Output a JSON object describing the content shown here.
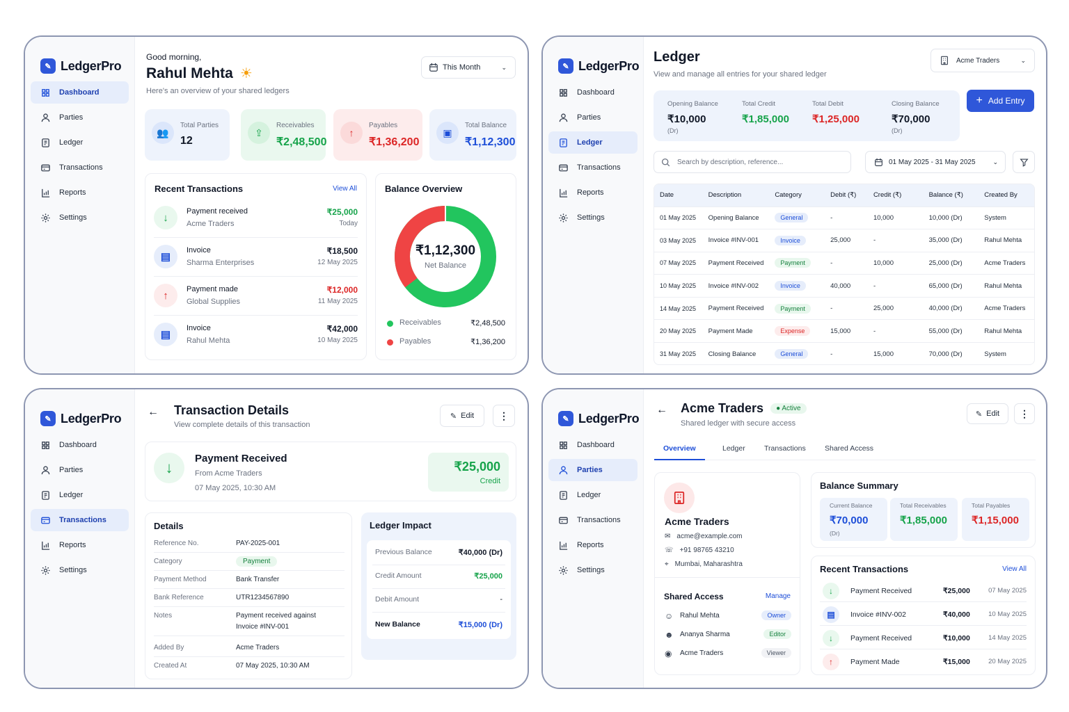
{
  "brand": "LedgerPro",
  "nav": [
    "Dashboard",
    "Parties",
    "Ledger",
    "Transactions",
    "Reports",
    "Settings"
  ],
  "dash": {
    "greeting": "Good morning,",
    "user": "Rahul Mehta",
    "subtitle": "Here's an overview of your shared ledgers",
    "period": "This Month",
    "stats": [
      {
        "label": "Total Parties",
        "value": "12"
      },
      {
        "label": "Receivables",
        "value": "₹2,48,500"
      },
      {
        "label": "Payables",
        "value": "₹1,36,200"
      },
      {
        "label": "Total Balance",
        "value": "₹1,12,300"
      }
    ],
    "recent_title": "Recent Transactions",
    "view_all": "View All",
    "recent": [
      {
        "title": "Payment received",
        "party": "Acme Traders",
        "amount": "₹25,000",
        "date": "Today"
      },
      {
        "title": "Invoice",
        "party": "Sharma Enterprises",
        "amount": "₹18,500",
        "date": "12 May 2025"
      },
      {
        "title": "Payment made",
        "party": "Global Supplies",
        "amount": "₹12,000",
        "date": "11 May 2025"
      },
      {
        "title": "Invoice",
        "party": "Rahul Mehta",
        "amount": "₹42,000",
        "date": "10 May 2025"
      }
    ],
    "balance_title": "Balance Overview",
    "donut_value": "₹1,12,300",
    "donut_label": "Net Balance",
    "legend": [
      {
        "label": "Receivables",
        "value": "₹2,48,500"
      },
      {
        "label": "Payables",
        "value": "₹1,36,200"
      }
    ],
    "donut_share": {
      "receivables": 248500,
      "payables": 136200
    },
    "colors": {
      "green": "#22c55e",
      "red": "#ef4444"
    }
  },
  "ledger": {
    "title": "Ledger",
    "subtitle": "View and manage all entries for your shared ledger",
    "party": "Acme Traders",
    "summary": [
      {
        "label": "Opening Balance",
        "value": "₹10,000",
        "note": "(Dr)"
      },
      {
        "label": "Total Credit",
        "value": "₹1,85,000",
        "note": ""
      },
      {
        "label": "Total Debit",
        "value": "₹1,25,000",
        "note": ""
      },
      {
        "label": "Closing Balance",
        "value": "₹70,000",
        "note": "(Dr)"
      }
    ],
    "add_entry": "Add Entry",
    "search_placeholder": "Search by description, reference...",
    "date_range": "01 May 2025 - 31 May 2025",
    "columns": [
      "Date",
      "Description",
      "Category",
      "Debit (₹)",
      "Credit (₹)",
      "Balance (₹)",
      "Created By"
    ],
    "rows": [
      [
        "01 May 2025",
        "Opening Balance",
        "General",
        "-",
        "10,000",
        "10,000 (Dr)",
        "System"
      ],
      [
        "03 May 2025",
        "Invoice #INV-001",
        "Invoice",
        "25,000",
        "-",
        "35,000 (Dr)",
        "Rahul Mehta"
      ],
      [
        "07 May 2025",
        "Payment Received",
        "Payment",
        "-",
        "10,000",
        "25,000 (Dr)",
        "Acme Traders"
      ],
      [
        "10 May 2025",
        "Invoice #INV-002",
        "Invoice",
        "40,000",
        "-",
        "65,000 (Dr)",
        "Rahul Mehta"
      ],
      [
        "14 May 2025",
        "Payment Received",
        "Payment",
        "-",
        "25,000",
        "40,000 (Dr)",
        "Acme Traders"
      ],
      [
        "20 May 2025",
        "Payment Made",
        "Expense",
        "15,000",
        "-",
        "55,000 (Dr)",
        "Rahul Mehta"
      ],
      [
        "31 May 2025",
        "Closing Balance",
        "General",
        "-",
        "15,000",
        "70,000 (Dr)",
        "System"
      ]
    ]
  },
  "txn": {
    "title": "Transaction Details",
    "subtitle": "View complete details of this transaction",
    "edit": "Edit",
    "head_title": "Payment Received",
    "head_from": "From Acme Traders",
    "head_date": "07 May 2025, 10:30 AM",
    "head_amount": "₹25,000",
    "head_type": "Credit",
    "details_title": "Details",
    "details": [
      {
        "k": "Reference No.",
        "v": "PAY-2025-001"
      },
      {
        "k": "Category",
        "v": "Payment"
      },
      {
        "k": "Payment Method",
        "v": "Bank Transfer"
      },
      {
        "k": "Bank Reference",
        "v": "UTR1234567890"
      },
      {
        "k": "Notes",
        "v": "Payment received against",
        "v2": "Invoice #INV-001"
      },
      {
        "k": "Added By",
        "v": "Acme Traders"
      },
      {
        "k": "Created At",
        "v": "07 May 2025, 10:30 AM"
      }
    ],
    "impact_title": "Ledger Impact",
    "impact": [
      {
        "k": "Previous Balance",
        "v": "₹40,000 (Dr)"
      },
      {
        "k": "Credit Amount",
        "v": "₹25,000"
      },
      {
        "k": "Debit Amount",
        "v": "-"
      },
      {
        "k": "New Balance",
        "v": "₹15,000 (Dr)"
      }
    ]
  },
  "party": {
    "name": "Acme Traders",
    "status": "Active",
    "subtitle": "Shared ledger with secure access",
    "edit": "Edit",
    "tabs": [
      "Overview",
      "Ledger",
      "Transactions",
      "Shared Access"
    ],
    "email": "acme@example.com",
    "phone": "+91 98765 43210",
    "location": "Mumbai, Maharashtra",
    "shared_title": "Shared Access",
    "manage": "Manage",
    "shared": [
      {
        "name": "Rahul Mehta",
        "role": "Owner"
      },
      {
        "name": "Ananya Sharma",
        "role": "Editor"
      },
      {
        "name": "Acme Traders",
        "role": "Viewer"
      }
    ],
    "balance_title": "Balance Summary",
    "balances": [
      {
        "label": "Current Balance",
        "value": "₹70,000",
        "note": "(Dr)"
      },
      {
        "label": "Total Receivables",
        "value": "₹1,85,000",
        "note": ""
      },
      {
        "label": "Total Payables",
        "value": "₹1,15,000",
        "note": ""
      }
    ],
    "recent_title": "Recent Transactions",
    "view_all": "View All",
    "recent": [
      {
        "title": "Payment Received",
        "amount": "₹25,000",
        "date": "07 May 2025"
      },
      {
        "title": "Invoice #INV-002",
        "amount": "₹40,000",
        "date": "10 May 2025"
      },
      {
        "title": "Payment Received",
        "amount": "₹10,000",
        "date": "14 May 2025"
      },
      {
        "title": "Payment Made",
        "amount": "₹15,000",
        "date": "20 May 2025"
      }
    ]
  }
}
